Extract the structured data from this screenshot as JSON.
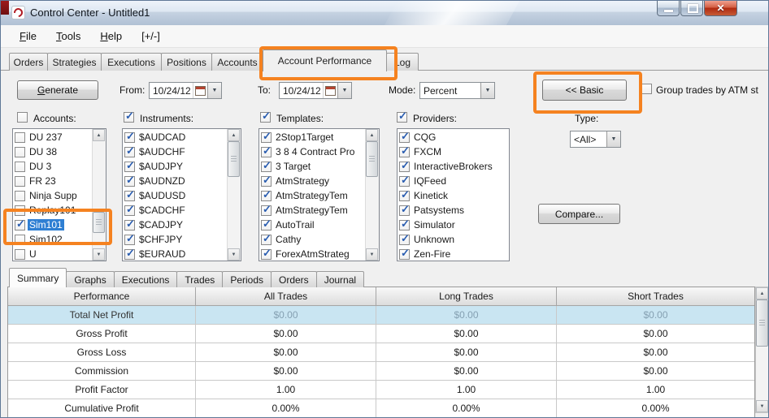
{
  "window": {
    "title": "Control Center - Untitled1"
  },
  "menu": {
    "items": [
      "File",
      "Tools",
      "Help",
      "[+/-]"
    ]
  },
  "tabs": [
    {
      "label": "Orders",
      "active": false
    },
    {
      "label": "Strategies",
      "active": false
    },
    {
      "label": "Executions",
      "active": false
    },
    {
      "label": "Positions",
      "active": false
    },
    {
      "label": "Accounts",
      "active": false
    },
    {
      "label": "Account Performance",
      "active": true
    },
    {
      "label": "Log",
      "active": false
    }
  ],
  "toolbar": {
    "generate": "Generate",
    "from_label": "From:",
    "from_value": "10/24/12",
    "to_label": "To:",
    "to_value": "10/24/12",
    "mode_label": "Mode:",
    "mode_value": "Percent",
    "basic": "<< Basic",
    "group_label": "Group trades by ATM st",
    "group_checked": false
  },
  "filters": {
    "accounts": {
      "label": "Accounts:",
      "checked": false,
      "items": [
        {
          "label": "DU 237",
          "checked": false,
          "selected": false
        },
        {
          "label": "DU 38",
          "checked": false,
          "selected": false
        },
        {
          "label": "DU 3",
          "checked": false,
          "selected": false
        },
        {
          "label": "FR 23",
          "checked": false,
          "selected": false
        },
        {
          "label": "Ninja Supp",
          "checked": false,
          "selected": false
        },
        {
          "label": "Replay101",
          "checked": false,
          "selected": false
        },
        {
          "label": "Sim101",
          "checked": true,
          "selected": true
        },
        {
          "label": "Sim102",
          "checked": false,
          "selected": false
        },
        {
          "label": "U",
          "checked": false,
          "selected": false
        }
      ]
    },
    "instruments": {
      "label": "Instruments:",
      "checked": true,
      "items": [
        {
          "label": "$AUDCAD",
          "checked": true
        },
        {
          "label": "$AUDCHF",
          "checked": true
        },
        {
          "label": "$AUDJPY",
          "checked": true
        },
        {
          "label": "$AUDNZD",
          "checked": true
        },
        {
          "label": "$AUDUSD",
          "checked": true
        },
        {
          "label": "$CADCHF",
          "checked": true
        },
        {
          "label": "$CADJPY",
          "checked": true
        },
        {
          "label": "$CHFJPY",
          "checked": true
        },
        {
          "label": "$EURAUD",
          "checked": true
        }
      ]
    },
    "templates": {
      "label": "Templates:",
      "checked": true,
      "items": [
        {
          "label": "2Stop1Target",
          "checked": true
        },
        {
          "label": "3 8 4 Contract Pro",
          "checked": true
        },
        {
          "label": "3 Target",
          "checked": true
        },
        {
          "label": "AtmStrategy",
          "checked": true
        },
        {
          "label": "AtmStrategyTem",
          "checked": true
        },
        {
          "label": "AtmStrategyTem",
          "checked": true
        },
        {
          "label": "AutoTrail",
          "checked": true
        },
        {
          "label": "Cathy",
          "checked": true
        },
        {
          "label": "ForexAtmStrateg",
          "checked": true
        }
      ]
    },
    "providers": {
      "label": "Providers:",
      "checked": true,
      "items": [
        {
          "label": "CQG",
          "checked": true
        },
        {
          "label": "FXCM",
          "checked": true
        },
        {
          "label": "InteractiveBrokers",
          "checked": true
        },
        {
          "label": "IQFeed",
          "checked": true
        },
        {
          "label": "Kinetick",
          "checked": true
        },
        {
          "label": "Patsystems",
          "checked": true
        },
        {
          "label": "Simulator",
          "checked": true
        },
        {
          "label": "Unknown",
          "checked": true
        },
        {
          "label": "Zen-Fire",
          "checked": true
        }
      ]
    },
    "type_label": "Type:",
    "type_value": "<All>",
    "compare": "Compare..."
  },
  "subtabs": [
    {
      "label": "Summary",
      "active": true
    },
    {
      "label": "Graphs",
      "active": false
    },
    {
      "label": "Executions",
      "active": false
    },
    {
      "label": "Trades",
      "active": false
    },
    {
      "label": "Periods",
      "active": false
    },
    {
      "label": "Orders",
      "active": false
    },
    {
      "label": "Journal",
      "active": false
    }
  ],
  "table": {
    "headers": [
      "Performance",
      "All Trades",
      "Long Trades",
      "Short Trades"
    ],
    "rows": [
      {
        "label": "Total Net Profit",
        "all": "$0.00",
        "long": "$0.00",
        "short": "$0.00",
        "highlight": true
      },
      {
        "label": "Gross Profit",
        "all": "$0.00",
        "long": "$0.00",
        "short": "$0.00",
        "highlight": false
      },
      {
        "label": "Gross Loss",
        "all": "$0.00",
        "long": "$0.00",
        "short": "$0.00",
        "highlight": false
      },
      {
        "label": "Commission",
        "all": "$0.00",
        "long": "$0.00",
        "short": "$0.00",
        "highlight": false
      },
      {
        "label": "Profit Factor",
        "all": "1.00",
        "long": "1.00",
        "short": "1.00",
        "highlight": false
      },
      {
        "label": "Cumulative Profit",
        "all": "0.00%",
        "long": "0.00%",
        "short": "0.00%",
        "highlight": false
      }
    ]
  },
  "annotations": {
    "highlight_color": "#f58220"
  }
}
